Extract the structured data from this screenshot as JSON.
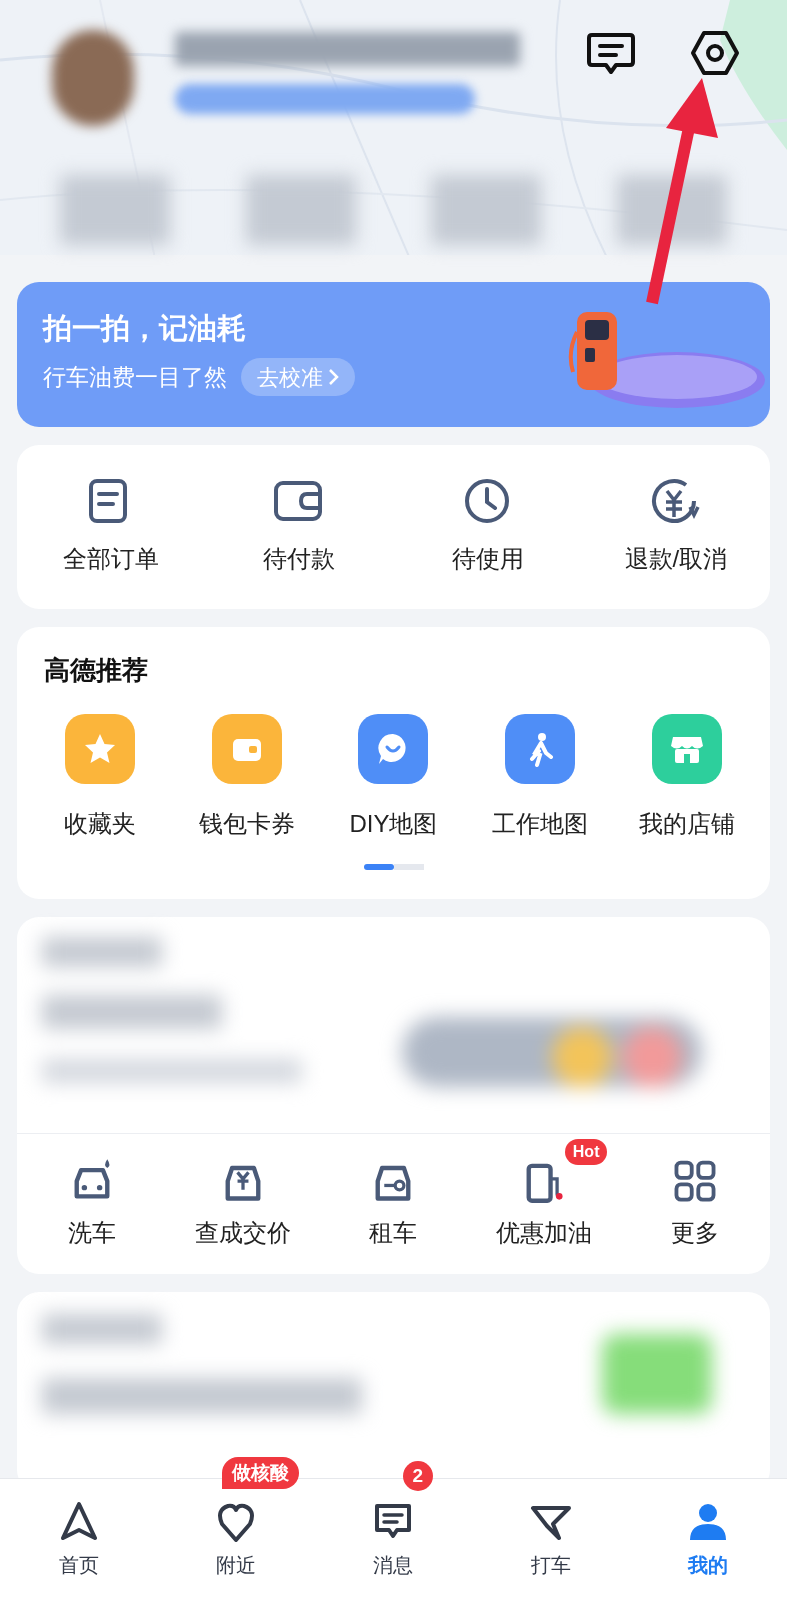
{
  "banner": {
    "title": "拍一拍，记油耗",
    "subtitle": "行车油费一目了然",
    "button": "去校准"
  },
  "orders": [
    {
      "label": "全部订单"
    },
    {
      "label": "待付款"
    },
    {
      "label": "待使用"
    },
    {
      "label": "退款/取消"
    }
  ],
  "recommend": {
    "title": "高德推荐",
    "items": [
      {
        "label": "收藏夹",
        "color": "#fbb53b"
      },
      {
        "label": "钱包卡券",
        "color": "#fbb53b"
      },
      {
        "label": "DIY地图",
        "color": "#4f8ef7"
      },
      {
        "label": "工作地图",
        "color": "#4f8ef7"
      },
      {
        "label": "我的店铺",
        "color": "#2dcf9c"
      }
    ],
    "pager": [
      {
        "selected": true
      },
      {
        "selected": false
      }
    ]
  },
  "services": [
    {
      "label": "洗车"
    },
    {
      "label": "查成交价"
    },
    {
      "label": "租车"
    },
    {
      "label": "优惠加油",
      "badge": "Hot"
    },
    {
      "label": "更多"
    }
  ],
  "nav": [
    {
      "label": "首页",
      "selected": false
    },
    {
      "label": "附近",
      "selected": false,
      "badge": "做核酸"
    },
    {
      "label": "消息",
      "selected": false,
      "badge": "2"
    },
    {
      "label": "打车",
      "selected": false
    },
    {
      "label": "我的",
      "selected": true
    }
  ]
}
